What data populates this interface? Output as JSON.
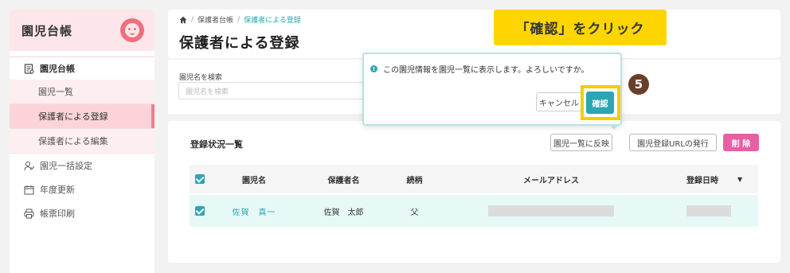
{
  "sidebar": {
    "title": "園児台帳",
    "group_label": "園児台帳",
    "sub_items": [
      "園児一覧",
      "保護者による登録",
      "保護者による編集"
    ],
    "items": [
      "園児一括設定",
      "年度更新",
      "帳票印刷"
    ]
  },
  "header": {
    "breadcrumb": {
      "first": "保護者台帳",
      "current": "保護者による登録",
      "separator": "/"
    },
    "title": "保護者による登録"
  },
  "search": {
    "label": "園児名を検索",
    "placeholder": "園児名を検索"
  },
  "list": {
    "title": "登録状況一覧",
    "buttons": {
      "reflect": "園児一覧に反映",
      "url": "園児登録URLの発行",
      "delete": "削 除"
    },
    "columns": {
      "child": "園児名",
      "guardian": "保護者名",
      "relation": "続柄",
      "email": "メールアドレス",
      "date": "登録日時"
    },
    "sort_icon": "▼",
    "rows": [
      {
        "child": "佐賀　真一",
        "guardian": "佐賀　太郎",
        "relation": "父",
        "checked": true
      }
    ]
  },
  "dialog": {
    "message": "この園児情報を園児一覧に表示します。よろしいですか。",
    "info_icon": "!",
    "cancel": "キャンセル",
    "confirm": "確認"
  },
  "annotation": {
    "callout": "「確認」をクリック",
    "step": "5",
    "highlight_color": "#f2cd00"
  },
  "colors": {
    "accent_teal": "#2aa7b3",
    "accent_pink": "#e85fa4",
    "sidebar_pink": "#fde6e9"
  }
}
